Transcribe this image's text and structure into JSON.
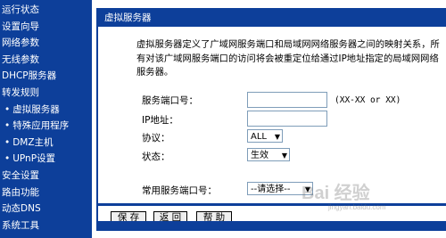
{
  "sidebar": {
    "items": [
      {
        "label": "运行状态"
      },
      {
        "label": "设置向导"
      },
      {
        "label": "网络参数"
      },
      {
        "label": "无线参数"
      },
      {
        "label": "DHCP服务器"
      },
      {
        "label": "转发规则"
      },
      {
        "label": "虚拟服务器"
      },
      {
        "label": "特殊应用程序"
      },
      {
        "label": "DMZ主机"
      },
      {
        "label": "UPnP设置"
      },
      {
        "label": "安全设置"
      },
      {
        "label": "路由功能"
      },
      {
        "label": "动态DNS"
      },
      {
        "label": "系统工具"
      }
    ]
  },
  "panel": {
    "title": "虚拟服务器",
    "description": "虚拟服务器定义了广域网服务端口和局域网网络服务器之间的映射关系，所有对该广域网服务端口的访问将会被重定位给通过IP地址指定的局域网网络服务器。"
  },
  "form": {
    "port_label": "服务端口号：",
    "port_value": "",
    "port_hint": "(XX-XX or XX)",
    "ip_label": "IP地址：",
    "ip_value": "",
    "protocol_label": "协议：",
    "protocol_value": "ALL",
    "status_label": "状态：",
    "status_value": "生效",
    "common_port_label": "常用服务端口号：",
    "common_port_value": "--请选择--"
  },
  "buttons": {
    "save": "保 存",
    "back": "返 回",
    "help": "帮 助"
  },
  "watermark": {
    "text": "Bai 经验",
    "sub": "jingyan.baidu.com"
  },
  "colors": {
    "brand_blue": "#0d3f9a"
  }
}
